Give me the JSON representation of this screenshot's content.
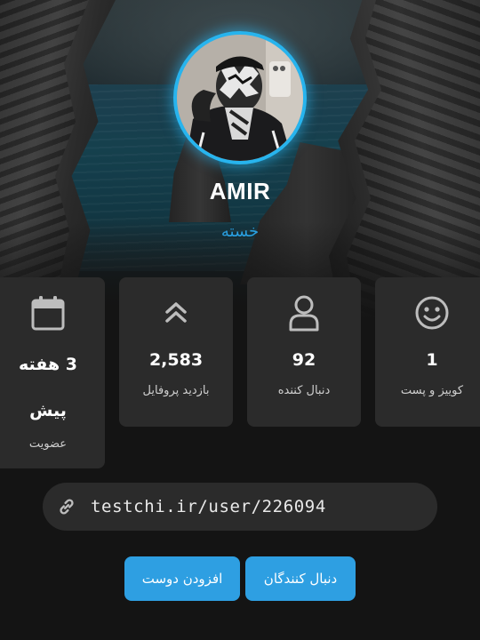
{
  "profile": {
    "username": "AMIR",
    "status": "خسته"
  },
  "stats": [
    {
      "icon": "smiley-icon",
      "value": "1",
      "label": "کوییز و پست"
    },
    {
      "icon": "user-icon",
      "value": "92",
      "label": "دنبال کننده"
    },
    {
      "icon": "double-chevron-up-icon",
      "value": "2,583",
      "label": "بازدید پروفایل"
    },
    {
      "icon": "calendar-icon",
      "value": "3 هفته پیش",
      "label": "عضویت"
    }
  ],
  "profile_link": {
    "icon": "link-icon",
    "url": "testchi.ir/user/226094"
  },
  "actions": {
    "followers_label": "دنبال کنندگان",
    "add_friend_label": "افزودن دوست"
  },
  "colors": {
    "accent": "#2e9fe2",
    "avatar_ring": "#27b4ee",
    "status_text": "#2a9fe0",
    "card_bg": "#2b2b2b",
    "page_bg": "#141414"
  }
}
